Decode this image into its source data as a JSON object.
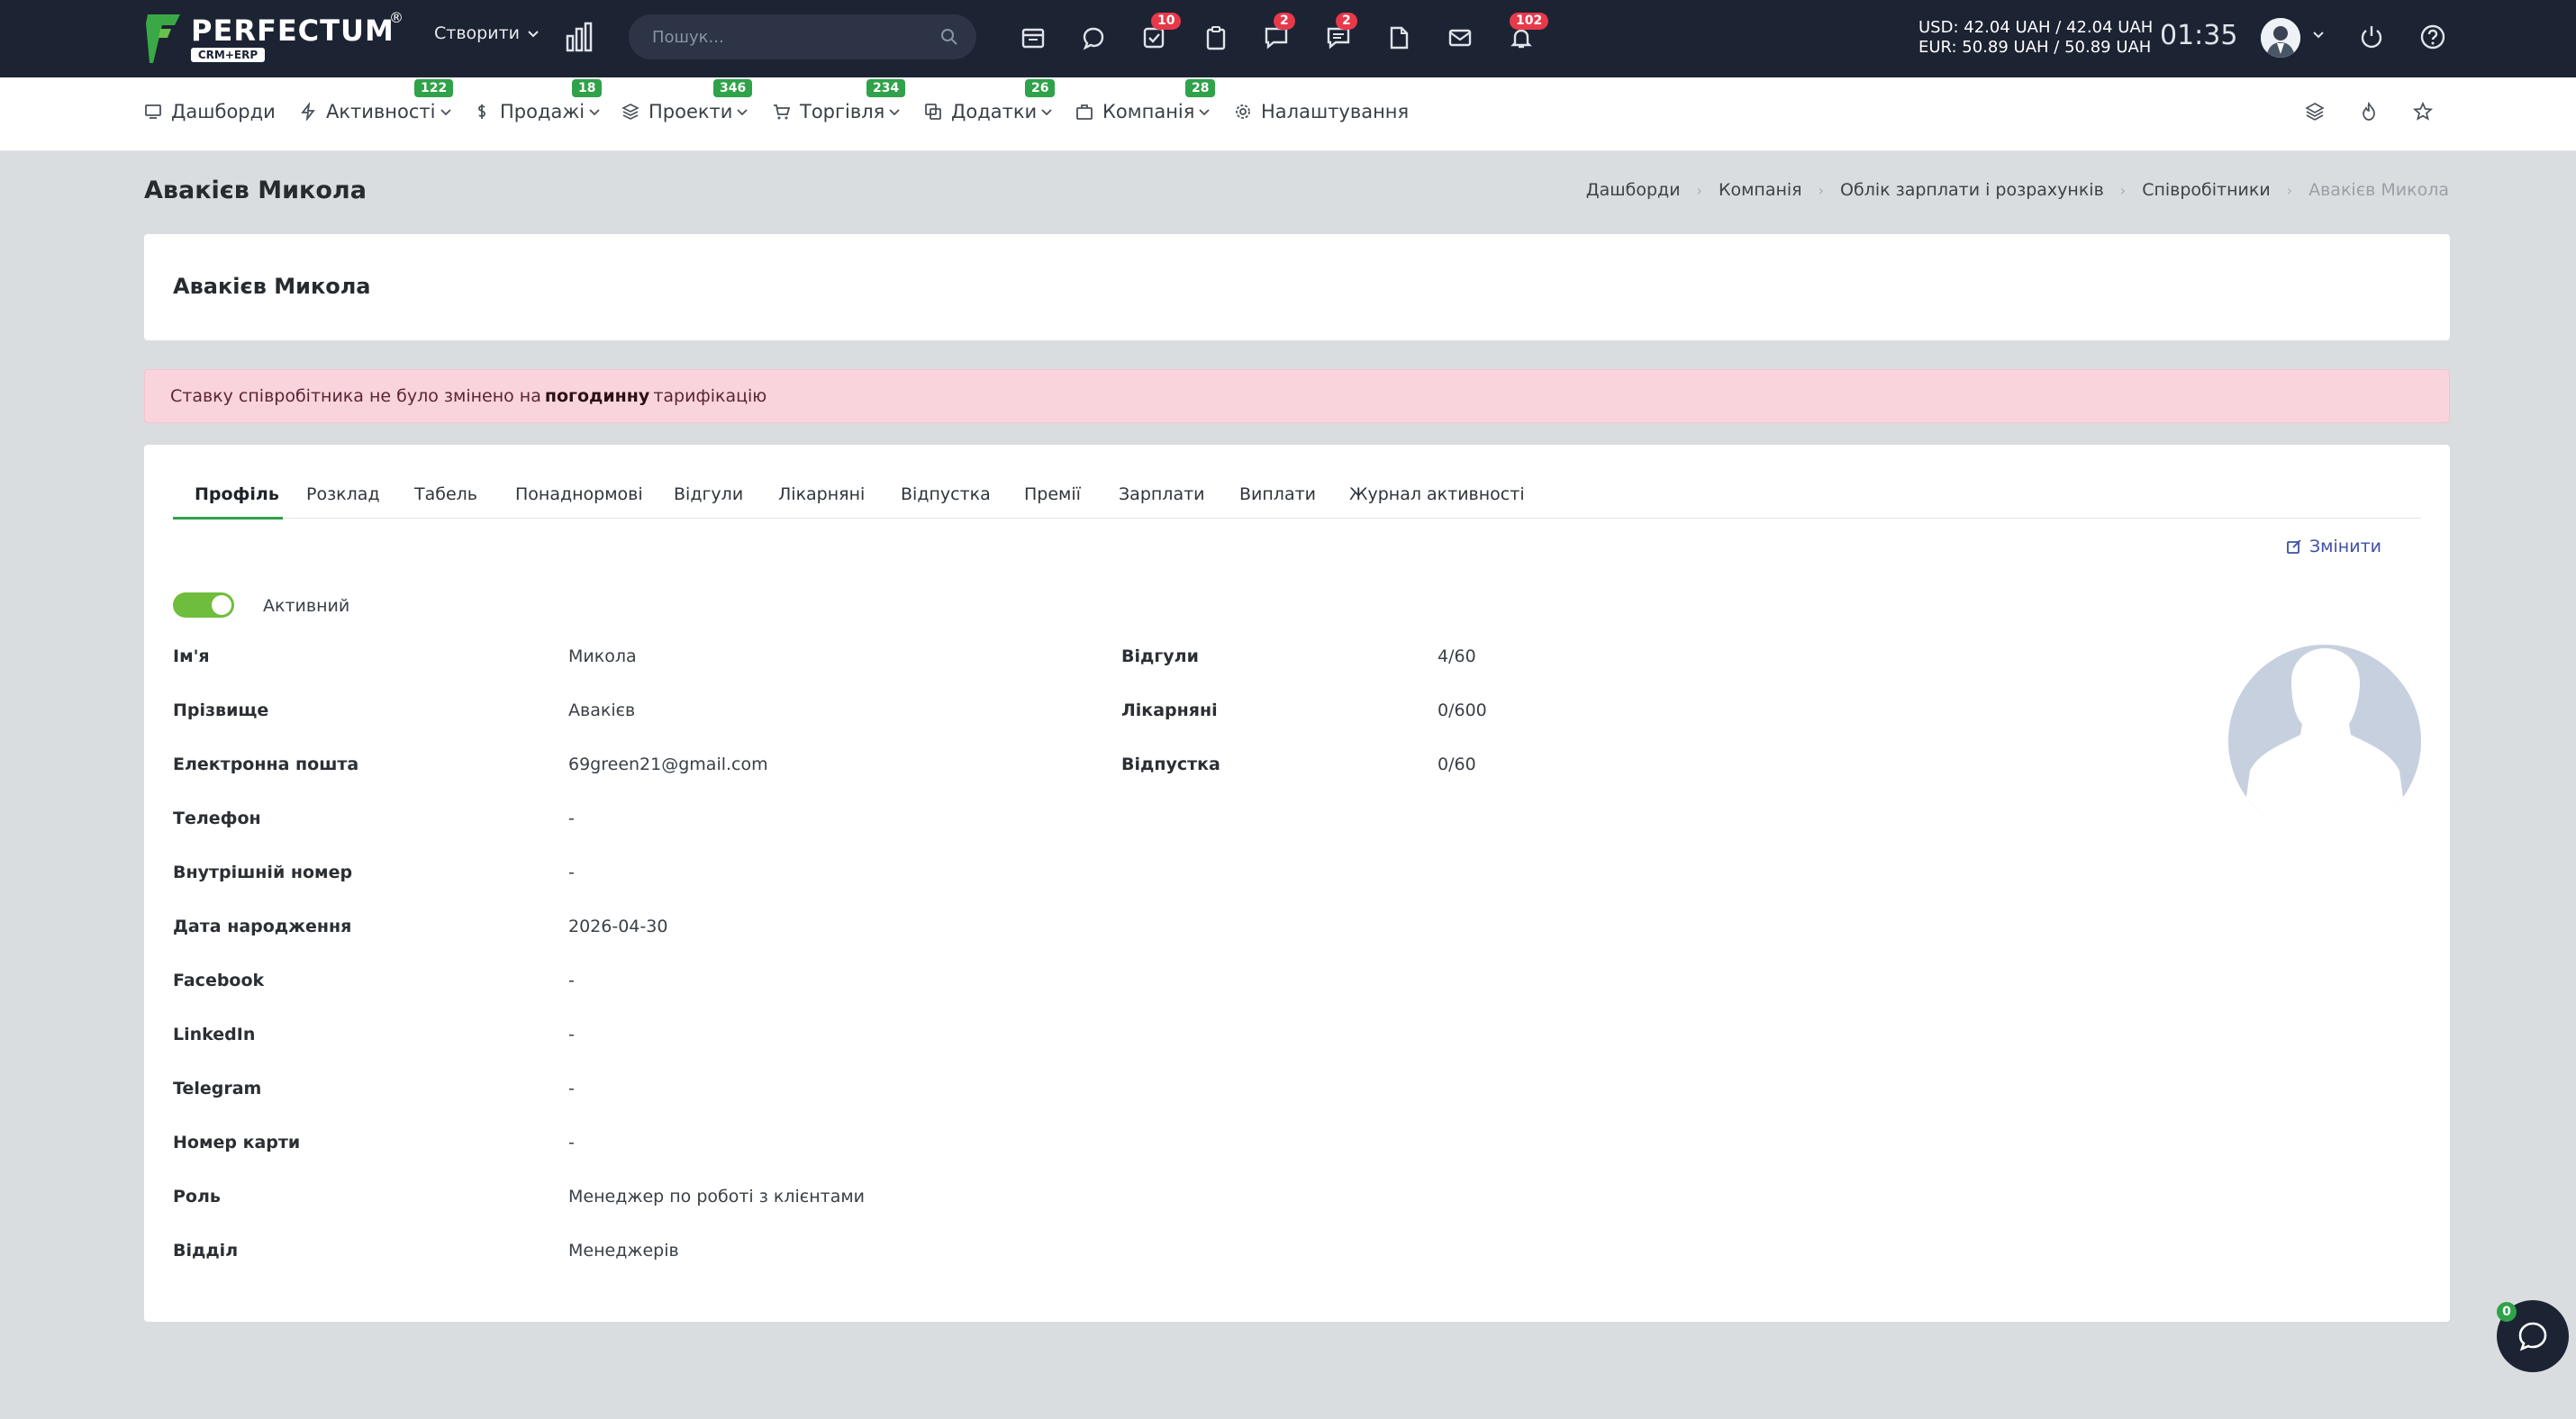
{
  "topbar": {
    "logo_text": "PERFECTUM",
    "logo_sub": "CRM+ERP",
    "logo_reg": "®",
    "create_label": "Створити",
    "search_placeholder": "Пошук...",
    "badges": {
      "tasks": "10",
      "chat": "2",
      "messages": "2",
      "notifications": "102"
    },
    "currency_usd": "USD: 42.04 UAH / 42.04 UAH",
    "currency_eur": "EUR: 50.89 UAH / 50.89 UAH",
    "time": "01:35"
  },
  "nav": {
    "items": [
      {
        "label": "Дашборди",
        "icon": "monitor-icon"
      },
      {
        "label": "Активності",
        "badge": "122",
        "icon": "bolt-icon"
      },
      {
        "label": "Продажі",
        "badge": "18",
        "icon": "dollar-icon"
      },
      {
        "label": "Проекти",
        "badge": "346",
        "icon": "layers-icon"
      },
      {
        "label": "Торгівля",
        "badge": "234",
        "icon": "cart-icon"
      },
      {
        "label": "Додатки",
        "badge": "26",
        "icon": "copy-icon"
      },
      {
        "label": "Компанія",
        "badge": "28",
        "icon": "briefcase-icon"
      },
      {
        "label": "Налаштування",
        "icon": "gear-icon"
      }
    ]
  },
  "page": {
    "title": "Авакієв Микола",
    "breadcrumb": [
      "Дашборди",
      "Компанія",
      "Облік зарплати і розрахунків",
      "Співробітники",
      "Авакієв Микола"
    ]
  },
  "header_card": {
    "title": "Авакієв Микола"
  },
  "alert": {
    "before": "Ставку співробітника не було змінено на",
    "bold": "погодинну",
    "after": "тарифікацію"
  },
  "tabs": [
    "Профіль",
    "Розклад",
    "Табель",
    "Понаднормові",
    "Відгули",
    "Лікарняні",
    "Відпустка",
    "Премії",
    "Зарплати",
    "Виплати",
    "Журнал активності"
  ],
  "profile": {
    "edit_label": "Змінити",
    "active_label": "Активний",
    "fields": [
      {
        "label": "Ім'я",
        "value": "Микола"
      },
      {
        "label": "Прізвище",
        "value": "Авакієв"
      },
      {
        "label": "Електронна пошта",
        "value": "69green21@gmail.com"
      },
      {
        "label": "Телефон",
        "value": "-"
      },
      {
        "label": "Внутрішній номер",
        "value": "-"
      },
      {
        "label": "Дата народження",
        "value": "2026-04-30"
      },
      {
        "label": "Facebook",
        "value": "-"
      },
      {
        "label": "LinkedIn",
        "value": "-"
      },
      {
        "label": "Telegram",
        "value": "-"
      },
      {
        "label": "Номер карти",
        "value": "-"
      },
      {
        "label": "Роль",
        "value": "Менеджер по роботі з клієнтами"
      },
      {
        "label": "Відділ",
        "value": "Менеджерів"
      }
    ],
    "leave": [
      {
        "label": "Відгули",
        "value": "4/60"
      },
      {
        "label": "Лікарняні",
        "value": "0/600"
      },
      {
        "label": "Відпустка",
        "value": "0/60"
      }
    ]
  },
  "chat": {
    "badge": "0"
  },
  "colors": {
    "topbar": "#1c2333",
    "accent_green": "#2fa24a",
    "badge_red": "#e8394b",
    "alert_bg": "#fad4dc",
    "link": "#3d4fa6"
  }
}
